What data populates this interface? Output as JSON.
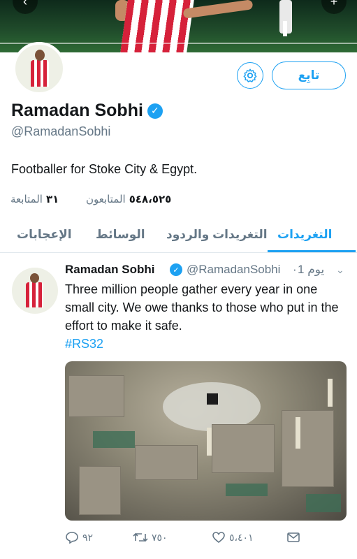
{
  "profile": {
    "display_name": "Ramadan Sobhi",
    "handle": "@RamadanSobhi",
    "bio": "Footballer for Stoke City & Egypt.",
    "follow_label": "تابِع",
    "followers_count": "٥٤٨،٥٢٥",
    "followers_label": "المتابعون",
    "following_count": "٣١",
    "following_label": "المتابعة"
  },
  "tabs": [
    {
      "label": "التغريدات",
      "active": true
    },
    {
      "label": "التغريدات والردود",
      "active": false
    },
    {
      "label": "الوسائط",
      "active": false
    },
    {
      "label": "الإعجابات",
      "active": false
    }
  ],
  "tweet": {
    "author_name": "Ramadan Sobhi",
    "author_handle": "@RamadanSobhi",
    "separator": "·",
    "time": "1 يوم",
    "text": "Three million people gather every year in one small city. We owe thanks to those who put in the effort to make it safe.",
    "hashtag": "#RS32",
    "replies": "٩٢",
    "retweets": "٧٥٠",
    "likes": "٥،٤٠١"
  },
  "colors": {
    "accent": "#1da1f2",
    "secondary_text": "#657786",
    "primary_text": "#14171a"
  },
  "icons": [
    "back-icon",
    "compose-icon",
    "gear-icon",
    "verified-icon",
    "chevron-down-icon",
    "reply-icon",
    "retweet-icon",
    "like-icon",
    "share-icon"
  ]
}
